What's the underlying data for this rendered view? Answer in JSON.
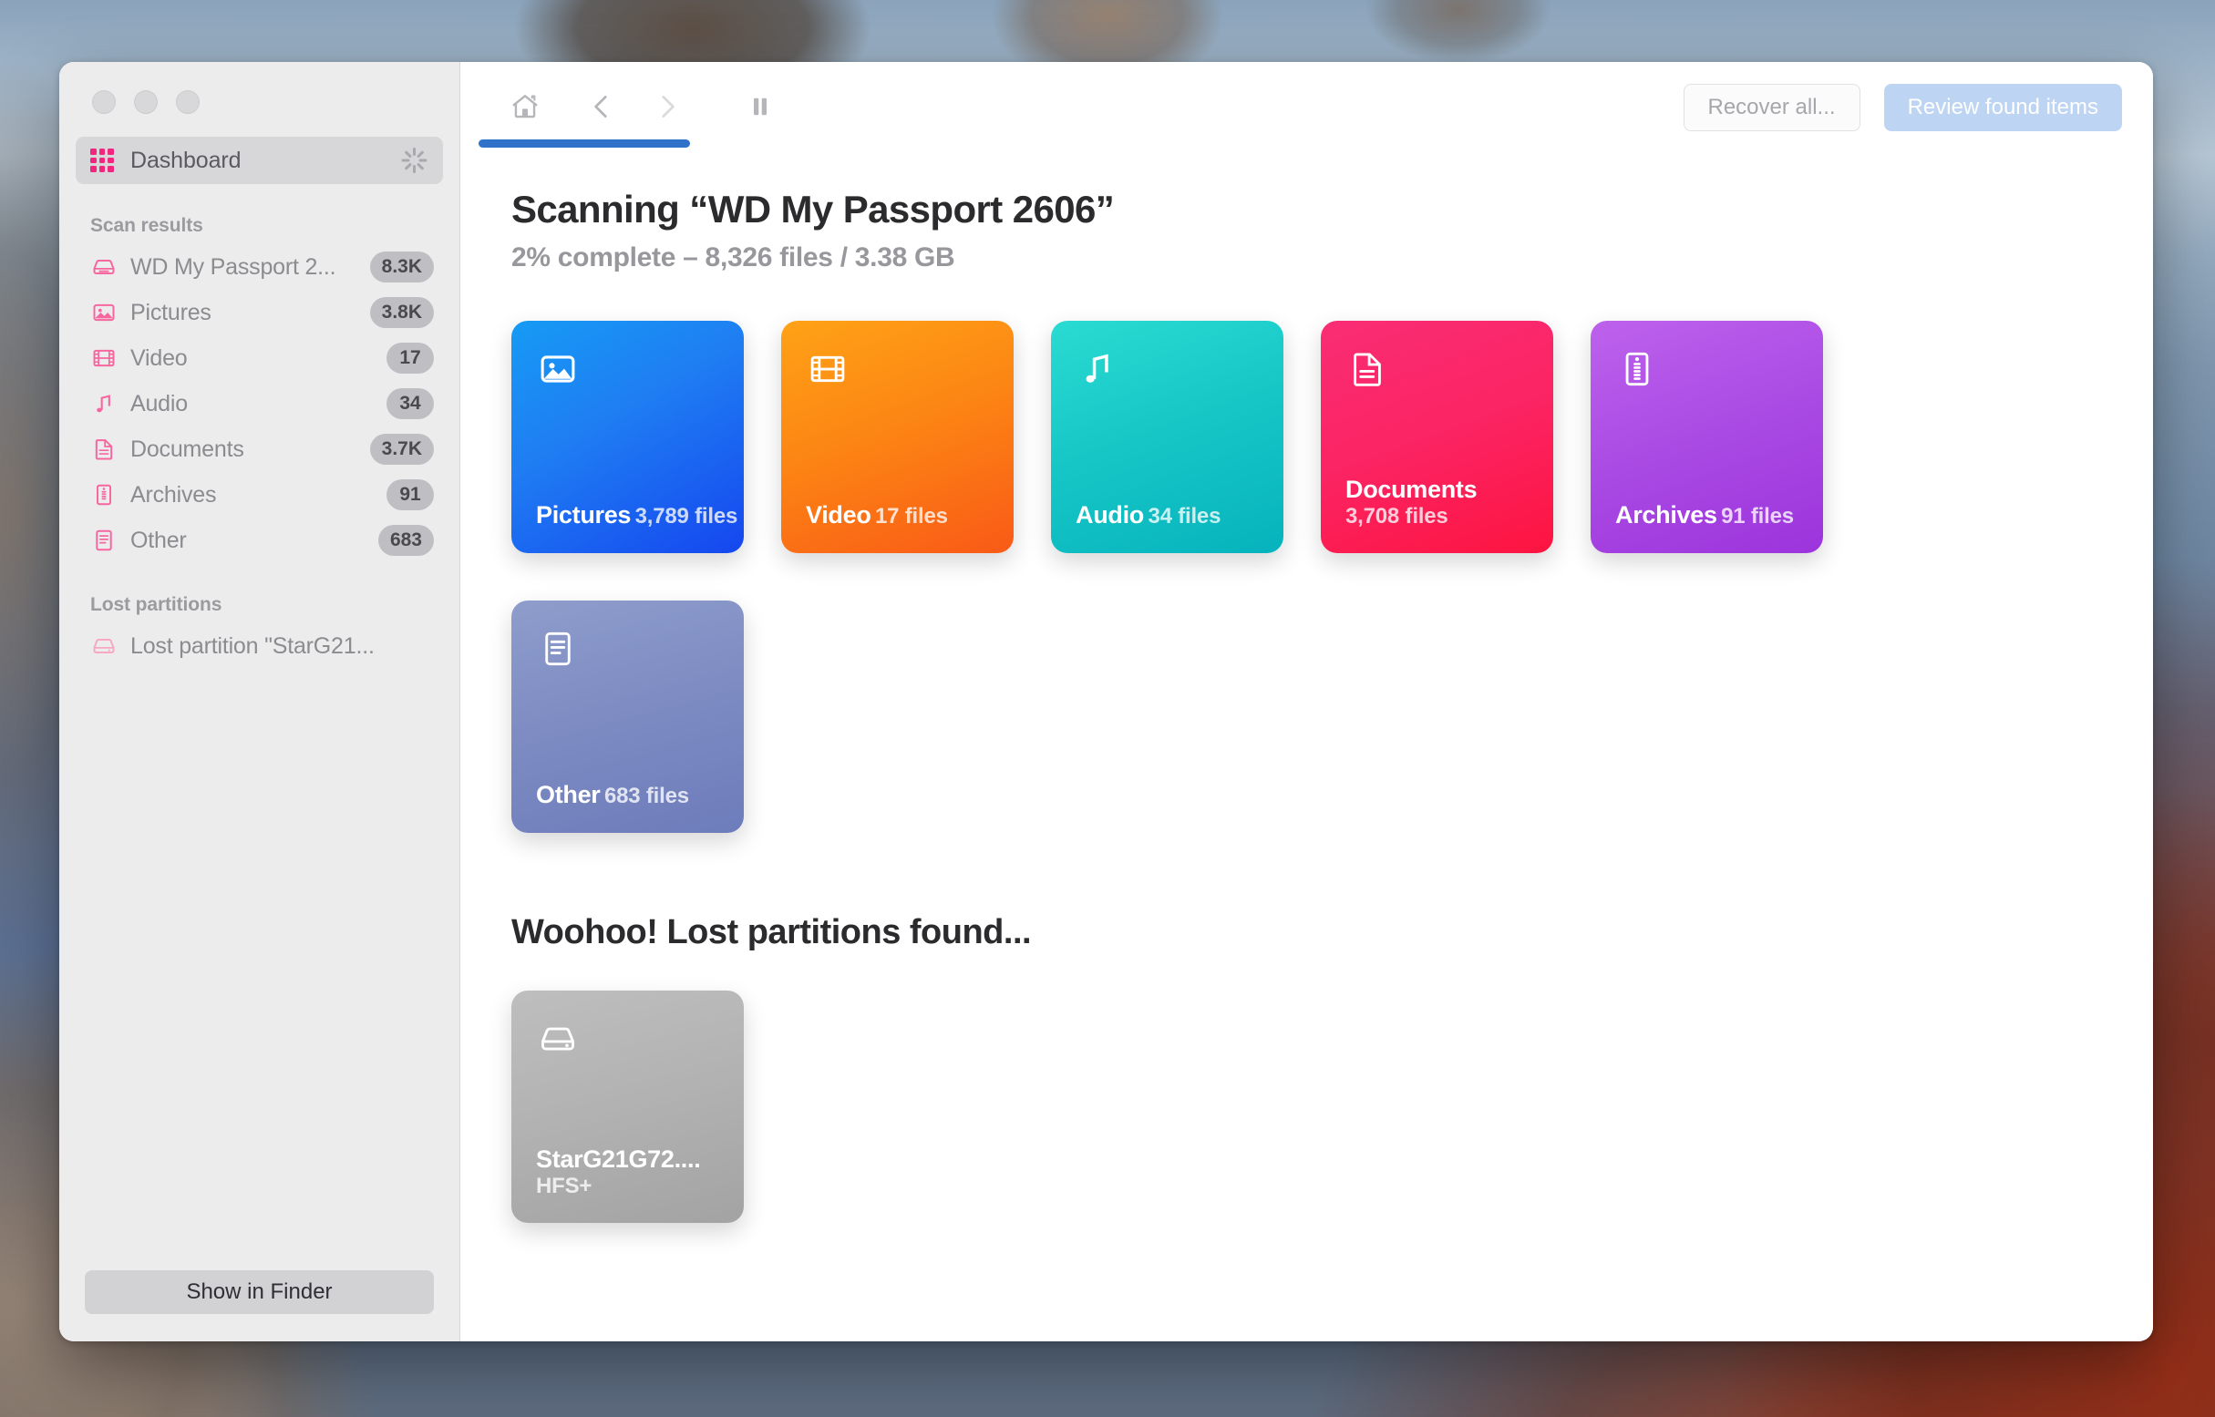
{
  "window": {
    "traffic_lights": [
      "close",
      "minimize",
      "zoom"
    ]
  },
  "sidebar": {
    "dashboard": {
      "label": "Dashboard",
      "icon": "grid-icon",
      "busy_icon": "spinner-icon",
      "selected": true
    },
    "groups": [
      {
        "title": "Scan results",
        "items": [
          {
            "label": "WD My Passport 2...",
            "badge": "8.3K",
            "icon": "hard-drive-icon"
          },
          {
            "label": "Pictures",
            "badge": "3.8K",
            "icon": "picture-icon"
          },
          {
            "label": "Video",
            "badge": "17",
            "icon": "film-icon"
          },
          {
            "label": "Audio",
            "badge": "34",
            "icon": "music-note-icon"
          },
          {
            "label": "Documents",
            "badge": "3.7K",
            "icon": "document-icon"
          },
          {
            "label": "Archives",
            "badge": "91",
            "icon": "zip-icon"
          },
          {
            "label": "Other",
            "badge": "683",
            "icon": "list-document-icon"
          }
        ]
      },
      {
        "title": "Lost partitions",
        "items": [
          {
            "label": "Lost partition \"StarG21...",
            "badge": "",
            "icon": "hard-drive-icon"
          }
        ]
      }
    ],
    "footer": {
      "show_in_finder_label": "Show in Finder"
    },
    "accent_color": "#f1267e"
  },
  "toolbar": {
    "buttons": [
      {
        "name": "home-icon",
        "label": "Home"
      },
      {
        "name": "back-icon",
        "label": "Back"
      },
      {
        "name": "forward-icon",
        "label": "Forward"
      },
      {
        "name": "pause-icon",
        "label": "Pause"
      }
    ],
    "recover_all_label": "Recover all...",
    "review_found_items_label": "Review found items",
    "recover_all_enabled": false,
    "review_found_items_enabled": false,
    "progress_color": "#3071c9"
  },
  "main": {
    "scan_title": "Scanning “WD My Passport 2606”",
    "scan_subtitle": "2% complete – 8,326 files / 3.38 GB",
    "progress_percent": "2%",
    "files_found": "8,326 files",
    "size_found": "3.38 GB",
    "tiles": [
      {
        "title": "Pictures",
        "sub": "3,789 files",
        "icon": "picture-icon",
        "color": "#1f7df2",
        "class": "t-pictures"
      },
      {
        "title": "Video",
        "sub": "17 files",
        "icon": "film-icon",
        "color": "#fc8614",
        "class": "t-video"
      },
      {
        "title": "Audio",
        "sub": "34 files",
        "icon": "music-note-icon",
        "color": "#16c6c6",
        "class": "t-audio"
      },
      {
        "title": "Documents",
        "sub": "3,708 files",
        "icon": "document-icon",
        "color": "#fb2464",
        "class": "t-documents"
      },
      {
        "title": "Archives",
        "sub": "91 files",
        "icon": "zip-icon",
        "color": "#ab4ce4",
        "class": "t-archives"
      },
      {
        "title": "Other",
        "sub": "683 files",
        "icon": "list-document-icon",
        "color": "#7e8cc3",
        "class": "t-other"
      }
    ],
    "partitions_title": "Woohoo! Lost partitions found...",
    "partitions": [
      {
        "title": "StarG21G72....",
        "sub": "HFS+",
        "icon": "hard-drive-icon",
        "color": "#b2b2b2",
        "class": "t-partition"
      }
    ]
  }
}
